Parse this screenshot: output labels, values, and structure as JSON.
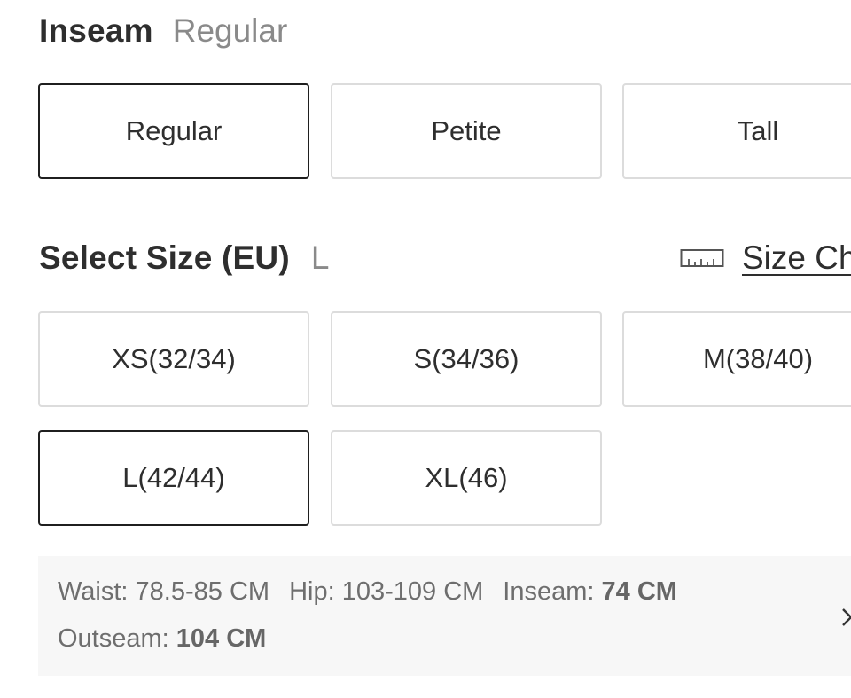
{
  "inseam": {
    "label": "Inseam",
    "selected_value": "Regular",
    "options": [
      "Regular",
      "Petite",
      "Tall"
    ]
  },
  "size": {
    "label": "Select Size (EU)",
    "selected_value": "L",
    "options": [
      "XS(32/34)",
      "S(34/36)",
      "M(38/40)",
      "L(42/44)",
      "XL(46)"
    ],
    "selected_option": "L(42/44)"
  },
  "size_chart": {
    "label": "Size Ch",
    "icon": "ruler-icon"
  },
  "measurements": {
    "waist_label": "Waist:",
    "waist_value": "78.5-85 CM",
    "hip_label": "Hip:",
    "hip_value": "103-109 CM",
    "inseam_label": "Inseam:",
    "inseam_value": "74 CM",
    "outseam_label": "Outseam:",
    "outseam_value": "104 CM",
    "close_icon": "close-icon"
  },
  "colors": {
    "selected_border": "#1f1f1f",
    "default_border": "#dcdcdc",
    "panel_background": "#f7f7f7"
  }
}
